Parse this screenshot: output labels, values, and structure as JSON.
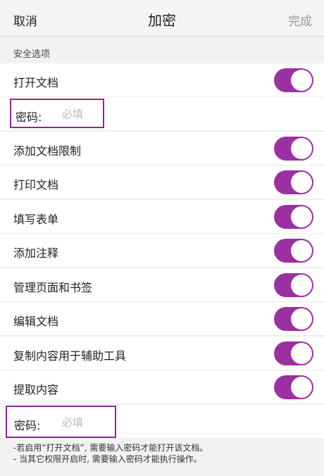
{
  "header": {
    "cancel_label": "取消",
    "title": "加密",
    "done_label": "完成"
  },
  "section_label": "安全选项",
  "open_doc": {
    "label": "打开文档",
    "on": true
  },
  "password_open": {
    "label": "密码:",
    "placeholder": "必填"
  },
  "permissions": [
    {
      "label": "添加文档限制",
      "on": true
    },
    {
      "label": "打印文档",
      "on": true
    },
    {
      "label": "填写表单",
      "on": true
    },
    {
      "label": "添加注释",
      "on": true
    },
    {
      "label": "管理页面和书签",
      "on": true
    },
    {
      "label": "编辑文档",
      "on": true
    },
    {
      "label": "复制内容用于辅助工具",
      "on": true
    },
    {
      "label": "提取内容",
      "on": true
    }
  ],
  "password_perm": {
    "label": "密码:",
    "placeholder": "必填"
  },
  "notes": [
    "-若启用“打开文档”, 需要输入密码才能打开该文档。",
    "- 当其它权限开启时, 需要输入密码才能执行操作。"
  ],
  "colors": {
    "accent": "#9b30a0",
    "highlight_border": "#8a2a8f"
  }
}
